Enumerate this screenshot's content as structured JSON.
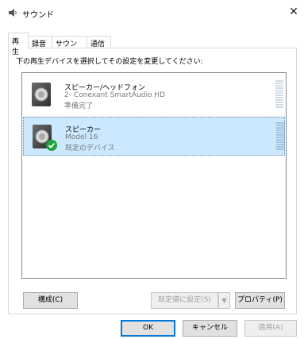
{
  "window": {
    "title": "サウンド",
    "close_glyph": "✕"
  },
  "tabs": [
    {
      "label": "再生",
      "active": true
    },
    {
      "label": "録音",
      "active": false
    },
    {
      "label": "サウンド",
      "active": false
    },
    {
      "label": "通信",
      "active": false
    }
  ],
  "instruction": "下の再生デバイスを選択してその設定を変更してください:",
  "devices": [
    {
      "name": "スピーカー/ヘッドフォン",
      "description": "2- Conexant SmartAudio HD",
      "status": "準備完了",
      "selected": false,
      "default": false
    },
    {
      "name": "スピーカー",
      "description": "Model 16",
      "status": "既定のデバイス",
      "selected": true,
      "default": true
    }
  ],
  "buttons": {
    "configure": "構成(C)",
    "set_default": "既定値に設定(S)",
    "dropdown_glyph": "▼",
    "properties": "プロパティ(P)",
    "ok": "OK",
    "cancel": "キャンセル",
    "apply": "適用(A)"
  },
  "colors": {
    "selection": "#cce8ff",
    "accent": "#0078d7",
    "check": "#1fa33b"
  }
}
